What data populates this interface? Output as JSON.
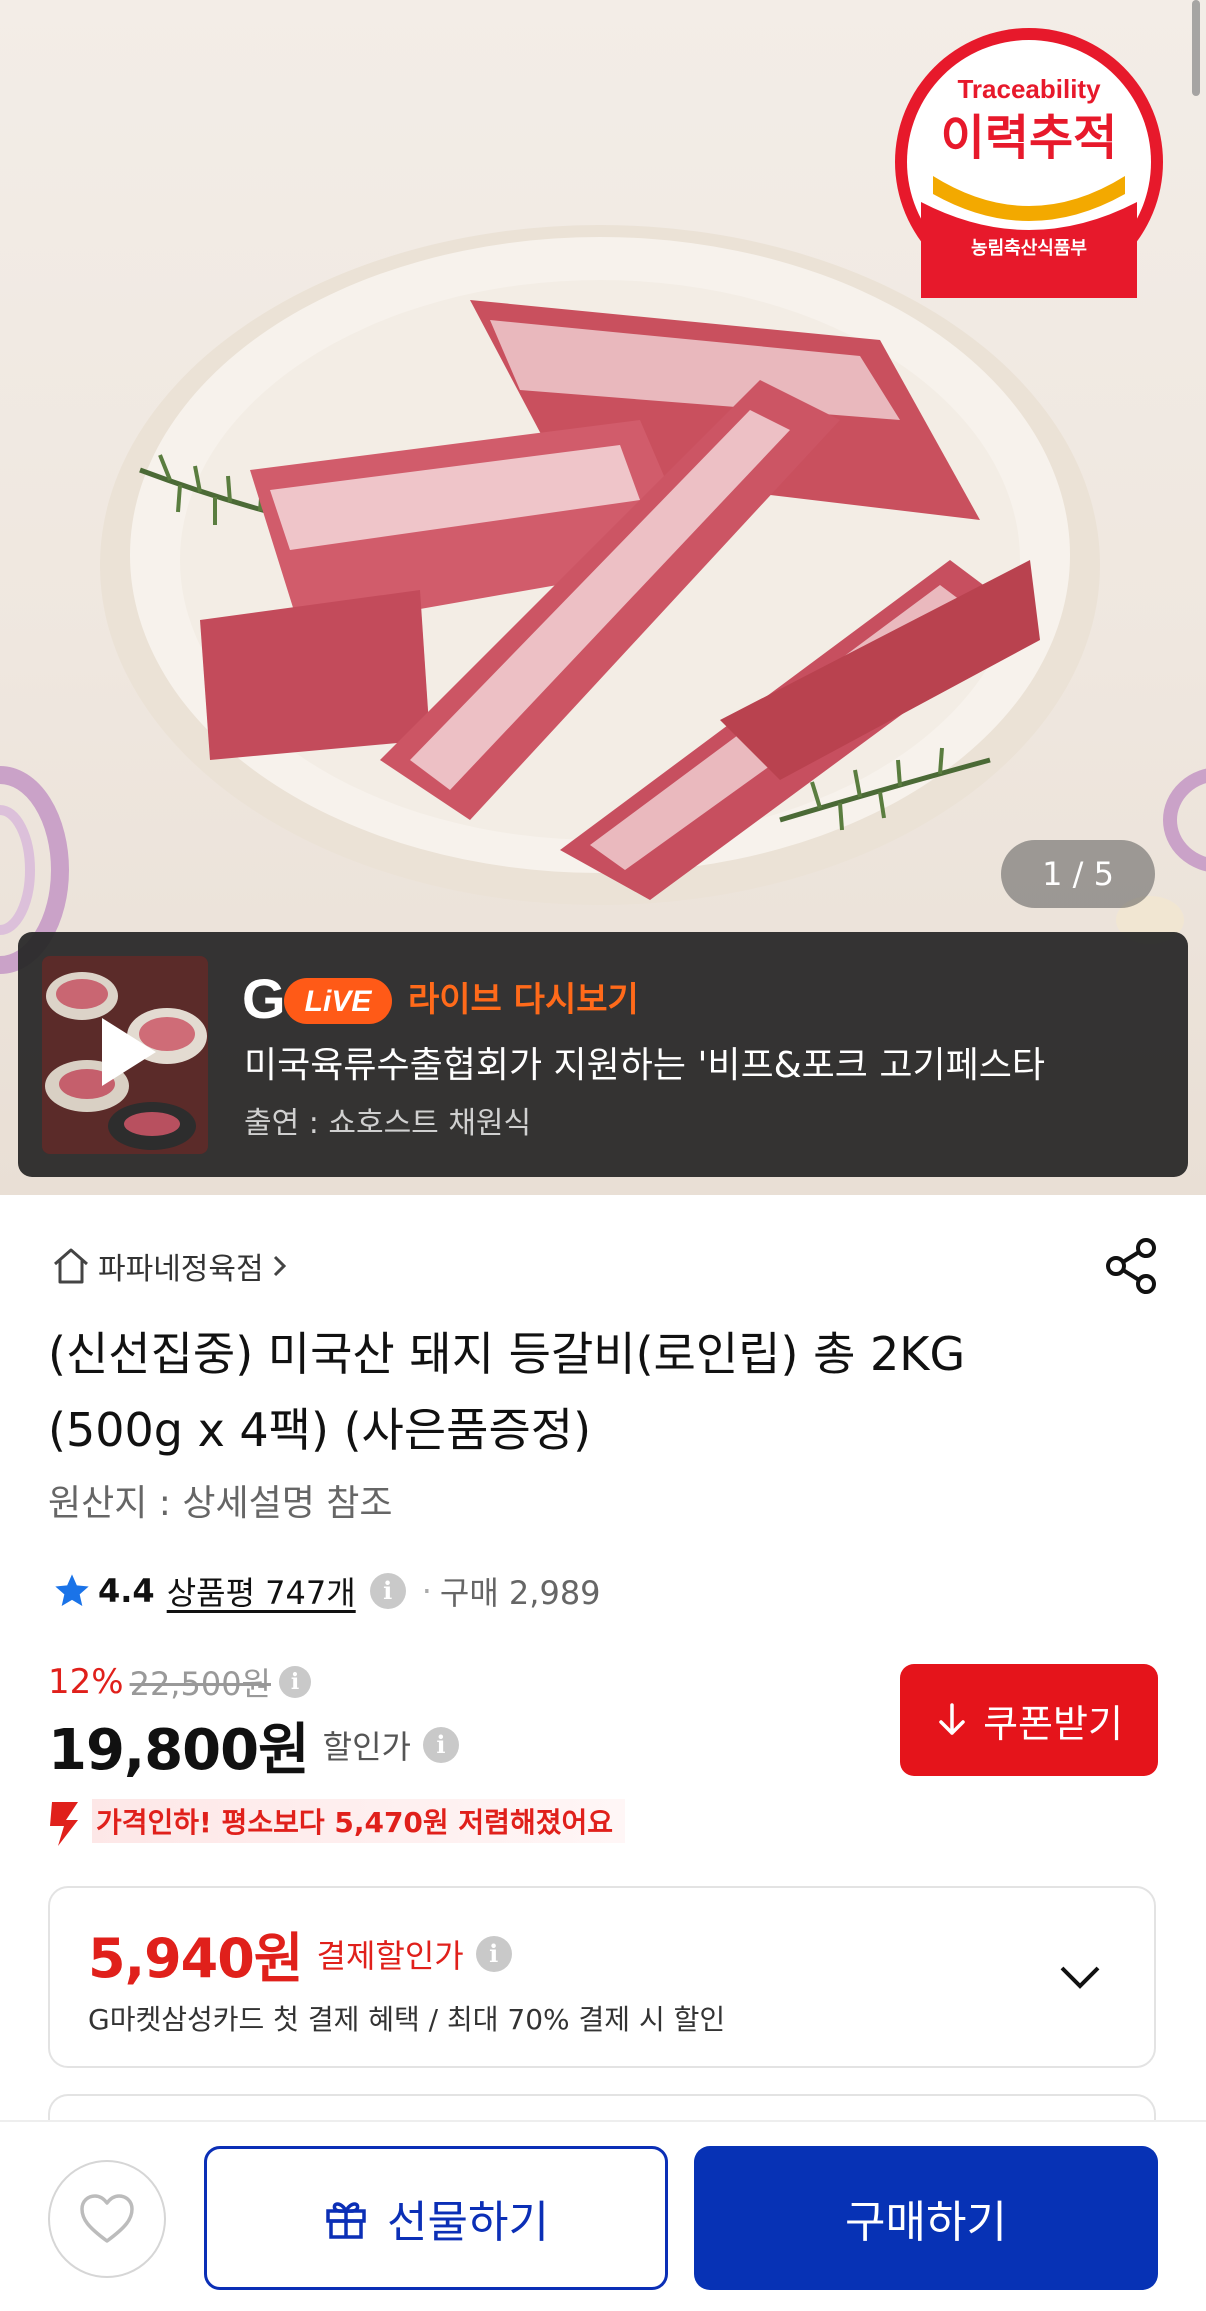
{
  "hero": {
    "badge": {
      "top": "Traceability",
      "main": "이력추적",
      "bottom": "농림축산식품부"
    },
    "counter": "1 / 5"
  },
  "live": {
    "logo_g": "G",
    "logo_live": "LiVE",
    "label": "라이브 다시보기",
    "title": "미국육류수출협회가 지원하는 '비프&포크 고기페스타",
    "host": "출연 : 쇼호스트 채원식"
  },
  "product": {
    "store": "파파네정육점",
    "title": "(신선집중) 미국산 돼지 등갈비(로인립) 총 2KG (500g x 4팩) (사은품증정)",
    "origin": "원산지 : 상세설명 참조",
    "rating": "4.4",
    "reviews": "상품평 747개",
    "separator": "·",
    "purchases": "구매 2,989",
    "discount_rate": "12%",
    "original_price": "22,500원",
    "price": "19,800원",
    "price_label": "할인가",
    "coupon_label": "쿠폰받기",
    "price_drop": "가격인하! 평소보다 5,470원 저렴해졌어요"
  },
  "payment": {
    "price": "5,940원",
    "label": "결제할인가",
    "desc": "G마켓삼성카드 첫 결제 혜택 / 최대 70% 결제 시 할인"
  },
  "bottom": {
    "gift_label": "선물하기",
    "buy_label": "구매하기"
  },
  "colors": {
    "accent_red": "#e5141b",
    "brand_blue": "#0732b5",
    "live_orange": "#ff6a1a"
  },
  "icons": [
    "home-icon",
    "chevron-right-icon",
    "share-icon",
    "star-icon",
    "info-icon",
    "download-icon",
    "price-drop-icon",
    "chevron-down-icon",
    "heart-icon",
    "gift-icon",
    "play-icon"
  ]
}
